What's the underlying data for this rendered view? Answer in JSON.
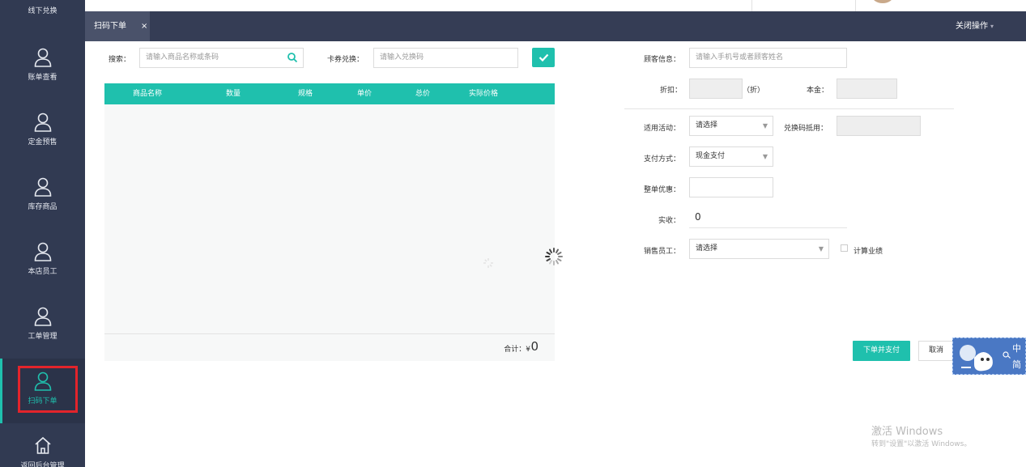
{
  "sidebar": {
    "items": [
      {
        "label": "线下兑换",
        "icon": "user-icon"
      },
      {
        "label": "账单查看",
        "icon": "user-icon"
      },
      {
        "label": "定金预售",
        "icon": "user-icon"
      },
      {
        "label": "库存商品",
        "icon": "user-icon"
      },
      {
        "label": "本店员工",
        "icon": "user-icon"
      },
      {
        "label": "工单管理",
        "icon": "user-icon"
      },
      {
        "label": "扫码下单",
        "icon": "user-icon",
        "active": true
      },
      {
        "label": "返回后台管理",
        "icon": "home-icon"
      }
    ]
  },
  "tabs": {
    "active_label": "扫码下单",
    "close_glyph": "×",
    "close_ops_label": "关闭操作",
    "close_ops_caret": "▾"
  },
  "search": {
    "label": "搜索：",
    "placeholder": "请输入商品名称或条码",
    "icon": "search-icon"
  },
  "coupon": {
    "label": "卡券兑换：",
    "placeholder": "请输入兑换码",
    "confirm_icon": "check-icon"
  },
  "table": {
    "columns": [
      "商品名称",
      "数量",
      "规格",
      "单价",
      "总价",
      "实际价格"
    ],
    "rows": [],
    "total_label": "合计：¥",
    "total_value": "0"
  },
  "form": {
    "customer_label": "顾客信息：",
    "customer_placeholder": "请输入手机号或者顾客姓名",
    "discount_label": "折扣：",
    "discount_unit": "（折）",
    "principal_label": "本金：",
    "activity_label": "适用活动：",
    "activity_value": "请选择",
    "redeem_label": "兑换码抵用：",
    "payment_label": "支付方式：",
    "payment_value": "现金支付",
    "order_discount_label": "整单优惠：",
    "received_label": "实收：",
    "received_value": "0",
    "staff_label": "销售员工：",
    "staff_value": "请选择",
    "calc_label": "计算业绩",
    "caret": "▼"
  },
  "actions": {
    "pay_label": "下单并支付",
    "cancel_label": "取消"
  },
  "ime": {
    "char1": "中",
    "char2": "简"
  },
  "watermark": {
    "title": "激活 Windows",
    "subtitle": "转到\"设置\"以激活 Windows。"
  },
  "colors": {
    "sidebar_bg": "#313a52",
    "accent": "#1fc0ad",
    "highlight": "#e3242b",
    "header_bg": "#353d55"
  }
}
